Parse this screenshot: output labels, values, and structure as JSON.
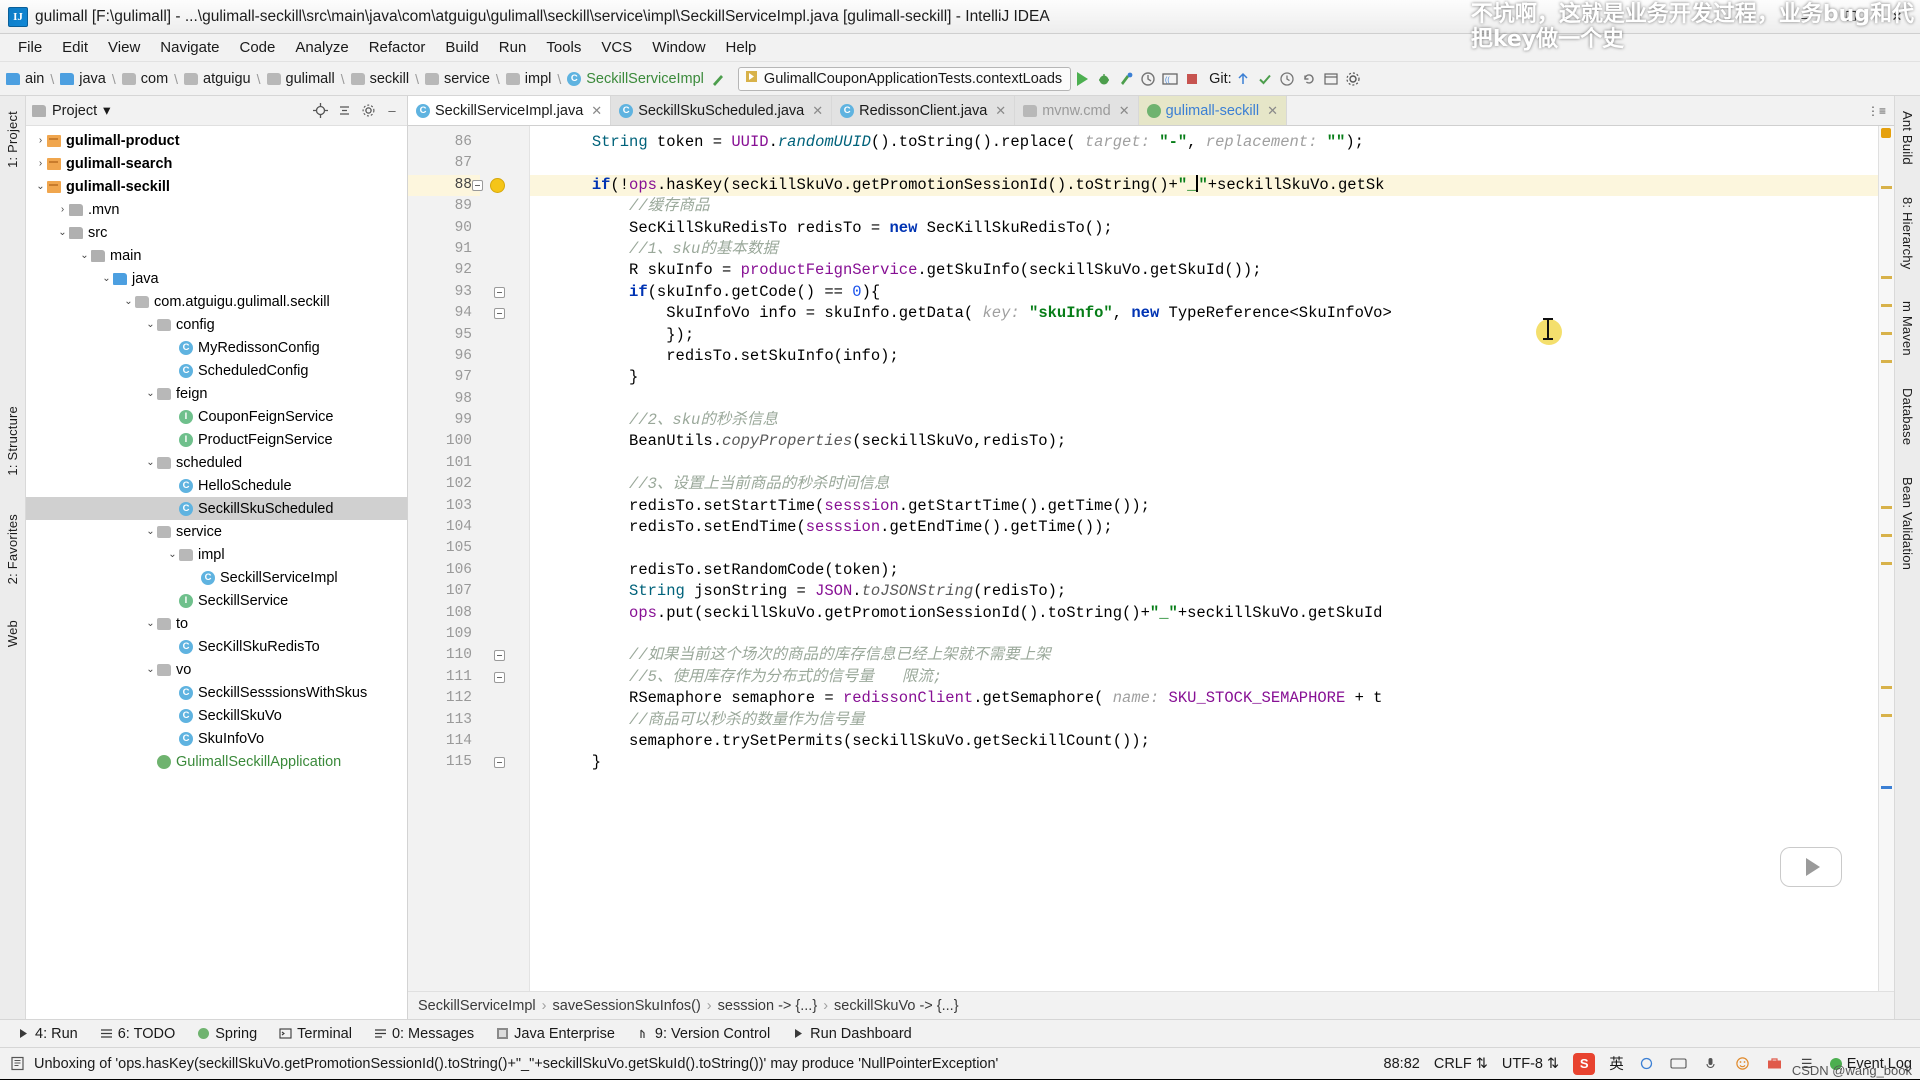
{
  "window": {
    "title": "gulimall [F:\\gulimall] - ...\\gulimall-seckill\\src\\main\\java\\com\\atguigu\\gulimall\\seckill\\service\\impl\\SeckillServiceImpl.java [gulimall-seckill] - IntelliJ IDEA",
    "logo_text": "IJ",
    "minimize": "–",
    "maximize": "❐",
    "close": "✕"
  },
  "menu": [
    {
      "label": "File"
    },
    {
      "label": "Edit"
    },
    {
      "label": "View"
    },
    {
      "label": "Navigate"
    },
    {
      "label": "Code"
    },
    {
      "label": "Analyze"
    },
    {
      "label": "Refactor"
    },
    {
      "label": "Build"
    },
    {
      "label": "Run"
    },
    {
      "label": "Tools"
    },
    {
      "label": "VCS"
    },
    {
      "label": "Window"
    },
    {
      "label": "Help"
    }
  ],
  "navbar": {
    "crumbs": [
      {
        "label": "ain",
        "icon": "folder-icon"
      },
      {
        "label": "java",
        "icon": "source-folder-icon"
      },
      {
        "label": "com",
        "icon": "package-icon"
      },
      {
        "label": "atguigu",
        "icon": "package-icon"
      },
      {
        "label": "gulimall",
        "icon": "package-icon"
      },
      {
        "label": "seckill",
        "icon": "package-icon"
      },
      {
        "label": "service",
        "icon": "package-icon"
      },
      {
        "label": "impl",
        "icon": "package-icon"
      },
      {
        "label": "SeckillServiceImpl",
        "icon": "class-icon"
      }
    ],
    "run_config": "GulimallCouponApplicationTests.contextLoads",
    "git_label": "Git:"
  },
  "project_panel": {
    "title": "Project",
    "dropdown_caret": "▾",
    "tree": [
      {
        "label": "gulimall-product",
        "depth": 1,
        "arrow": "›",
        "icon": "module-icon",
        "bold": true
      },
      {
        "label": "gulimall-search",
        "depth": 1,
        "arrow": "›",
        "icon": "module-icon",
        "bold": true
      },
      {
        "label": "gulimall-seckill",
        "depth": 1,
        "arrow": "⌄",
        "icon": "module-icon",
        "bold": true
      },
      {
        "label": ".mvn",
        "depth": 2,
        "arrow": "›",
        "icon": "folder-icon"
      },
      {
        "label": "src",
        "depth": 2,
        "arrow": "⌄",
        "icon": "folder-icon"
      },
      {
        "label": "main",
        "depth": 3,
        "arrow": "⌄",
        "icon": "folder-icon"
      },
      {
        "label": "java",
        "depth": 4,
        "arrow": "⌄",
        "icon": "source-folder-icon"
      },
      {
        "label": "com.atguigu.gulimall.seckill",
        "depth": 5,
        "arrow": "⌄",
        "icon": "package-icon"
      },
      {
        "label": "config",
        "depth": 6,
        "arrow": "⌄",
        "icon": "package-icon"
      },
      {
        "label": "MyRedissonConfig",
        "depth": 7,
        "arrow": "",
        "icon": "class-icon"
      },
      {
        "label": "ScheduledConfig",
        "depth": 7,
        "arrow": "",
        "icon": "class-icon"
      },
      {
        "label": "feign",
        "depth": 6,
        "arrow": "⌄",
        "icon": "package-icon"
      },
      {
        "label": "CouponFeignService",
        "depth": 7,
        "arrow": "",
        "icon": "interface-icon"
      },
      {
        "label": "ProductFeignService",
        "depth": 7,
        "arrow": "",
        "icon": "interface-icon"
      },
      {
        "label": "scheduled",
        "depth": 6,
        "arrow": "⌄",
        "icon": "package-icon"
      },
      {
        "label": "HelloSchedule",
        "depth": 7,
        "arrow": "",
        "icon": "class-icon"
      },
      {
        "label": "SeckillSkuScheduled",
        "depth": 7,
        "arrow": "",
        "icon": "class-icon",
        "selected": true
      },
      {
        "label": "service",
        "depth": 6,
        "arrow": "⌄",
        "icon": "package-icon"
      },
      {
        "label": "impl",
        "depth": 7,
        "arrow": "⌄",
        "icon": "package-icon"
      },
      {
        "label": "SeckillServiceImpl",
        "depth": 8,
        "arrow": "",
        "icon": "class-icon"
      },
      {
        "label": "SeckillService",
        "depth": 7,
        "arrow": "",
        "icon": "interface-icon"
      },
      {
        "label": "to",
        "depth": 6,
        "arrow": "⌄",
        "icon": "package-icon"
      },
      {
        "label": "SecKillSkuRedisTo",
        "depth": 7,
        "arrow": "",
        "icon": "class-icon"
      },
      {
        "label": "vo",
        "depth": 6,
        "arrow": "⌄",
        "icon": "package-icon"
      },
      {
        "label": "SeckillSesssionsWithSkus",
        "depth": 7,
        "arrow": "",
        "icon": "class-icon"
      },
      {
        "label": "SeckillSkuVo",
        "depth": 7,
        "arrow": "",
        "icon": "class-icon"
      },
      {
        "label": "SkuInfoVo",
        "depth": 7,
        "arrow": "",
        "icon": "class-icon"
      },
      {
        "label": "GulimallSeckillApplication",
        "depth": 6,
        "arrow": "",
        "icon": "spring-icon",
        "green": true
      }
    ]
  },
  "left_strip": [
    {
      "label": "1: Project"
    },
    {
      "label": "1: Structure"
    },
    {
      "label": "2: Favorites"
    },
    {
      "label": "Web"
    }
  ],
  "right_strip": [
    {
      "label": "Ant Build"
    },
    {
      "label": "8: Hierarchy"
    },
    {
      "label": "m Maven"
    },
    {
      "label": "Database"
    },
    {
      "label": "Bean Validation"
    }
  ],
  "editor_tabs": [
    {
      "label": "SeckillServiceImpl.java",
      "icon": "class-icon",
      "active": true,
      "close": "✕"
    },
    {
      "label": "SeckillSkuScheduled.java",
      "icon": "class-icon",
      "active": false,
      "close": "✕"
    },
    {
      "label": "RedissonClient.java",
      "icon": "class-icon",
      "active": false,
      "close": "✕"
    },
    {
      "label": "mvnw.cmd",
      "icon": "file-icon",
      "active": false,
      "close": "✕"
    },
    {
      "label": "gulimall-seckill",
      "icon": "maven-icon",
      "active": false,
      "close": "✕"
    }
  ],
  "code": {
    "first_line": 86,
    "current_line": 88,
    "lines": [
      {
        "n": 86,
        "html": "      <s class='mth'>String</s> token = <s class='fld'>UUID</s>.<s class='mthi'>randomUUID</s>().toString().replace( <s class='hint'>target:</s> <s class='st'>\"-\"</s>, <s class='hint'>replacement:</s> <s class='st'>\"\"</s>);"
      },
      {
        "n": 87,
        "html": ""
      },
      {
        "n": 88,
        "cur": true,
        "html": "      <s class='kw'>if</s>(!<s class='fld'>ops</s>.hasKey(seckillSkuVo.getPromotionSessionId().toString()+<s class='st'>\"_</s>CARET<s class='st'>\"</s>+seckillSkuVo.getSk"
      },
      {
        "n": 89,
        "html": "          <s class='cmz'>//缓存商品</s>"
      },
      {
        "n": 90,
        "html": "          SecKillSkuRedisTo redisTo = <s class='kw'>new</s> SecKillSkuRedisTo();"
      },
      {
        "n": 91,
        "html": "          <s class='cmz'>//1、sku的基本数据</s>"
      },
      {
        "n": 92,
        "html": "          R skuInfo = <s class='fld'>productFeignService</s>.getSkuInfo(seckillSkuVo.getSkuId());"
      },
      {
        "n": 93,
        "html": "          <s class='kw'>if</s>(skuInfo.getCode() == <s class='num'>0</s>){"
      },
      {
        "n": 94,
        "html": "              SkuInfoVo info = skuInfo.getData( <s class='hint'>key:</s> <s class='st'>\"skuInfo\"</s>, <s class='kw'>new</s> TypeReference&lt;SkuInfoVo&gt;"
      },
      {
        "n": 95,
        "html": "              });"
      },
      {
        "n": 96,
        "html": "              redisTo.setSkuInfo(info);"
      },
      {
        "n": 97,
        "html": "          }"
      },
      {
        "n": 98,
        "html": ""
      },
      {
        "n": 99,
        "html": "          <s class='cmz'>//2、sku的秒杀信息</s>"
      },
      {
        "n": 100,
        "html": "          BeanUtils.<s class='stat'>copyProperties</s>(seckillSkuVo,redisTo);"
      },
      {
        "n": 101,
        "html": ""
      },
      {
        "n": 102,
        "html": "          <s class='cmz'>//3、设置上当前商品的秒杀时间信息</s>"
      },
      {
        "n": 103,
        "html": "          redisTo.setStartTime(<s class='fld'>sesssion</s>.getStartTime().getTime());"
      },
      {
        "n": 104,
        "html": "          redisTo.setEndTime(<s class='fld'>sesssion</s>.getEndTime().getTime());"
      },
      {
        "n": 105,
        "html": ""
      },
      {
        "n": 106,
        "html": "          redisTo.setRandomCode(token);"
      },
      {
        "n": 107,
        "html": "          <s class='mth'>String</s> jsonString = <s class='fld'>JSON</s>.<s class='stat'>toJSONString</s>(redisTo);"
      },
      {
        "n": 108,
        "html": "          <s class='fld'>ops</s>.put(seckillSkuVo.getPromotionSessionId().toString()+<s class='st'>\"_\"</s>+seckillSkuVo.getSkuId"
      },
      {
        "n": 109,
        "html": ""
      },
      {
        "n": 110,
        "html": "          <s class='cmz'>//如果当前这个场次的商品的库存信息已经上架就不需要上架</s>"
      },
      {
        "n": 111,
        "html": "          <s class='cmz'>//5、使用库存作为分布式的信号量   限流;</s>"
      },
      {
        "n": 112,
        "html": "          RSemaphore semaphore = <s class='fld'>redissonClient</s>.getSemaphore( <s class='hint'>name:</s> <s class='fld'>SKU_STOCK_SEMAPHORE</s> + t"
      },
      {
        "n": 113,
        "html": "          <s class='cmz'>//商品可以秒杀的数量作为信号量</s>"
      },
      {
        "n": 114,
        "html": "          semaphore.trySetPermits(seckillSkuVo.getSeckillCount());"
      },
      {
        "n": 115,
        "html": "      }"
      }
    ]
  },
  "editor_breadcrumbs": [
    {
      "label": "SeckillServiceImpl"
    },
    {
      "label": "saveSessionSkuInfos()"
    },
    {
      "label": "sesssion -> {...}"
    },
    {
      "label": "seckillSkuVo -> {...}"
    }
  ],
  "tool_windows": [
    {
      "label": "4: Run",
      "mnemonic": "4",
      "icon": "run-icon"
    },
    {
      "label": "6: TODO",
      "mnemonic": "6",
      "icon": "todo-icon"
    },
    {
      "label": "Spring",
      "mnemonic": "",
      "icon": "spring-icon"
    },
    {
      "label": "Terminal",
      "mnemonic": "",
      "icon": "terminal-icon"
    },
    {
      "label": "0: Messages",
      "mnemonic": "0",
      "icon": "messages-icon"
    },
    {
      "label": "Java Enterprise",
      "mnemonic": "",
      "icon": "java-enterprise-icon"
    },
    {
      "label": "9: Version Control",
      "mnemonic": "9",
      "icon": "version-control-icon"
    },
    {
      "label": "Run Dashboard",
      "mnemonic": "",
      "icon": "dashboard-icon"
    }
  ],
  "status_bar": {
    "message": "Unboxing of 'ops.hasKey(seckillSkuVo.getPromotionSessionId().toString()+\"_\"+seckillSkuVo.getSkuId().toString())' may produce 'NullPointerException'",
    "caret_position": "88:82",
    "line_separator": "CRLF",
    "encoding": "UTF-8",
    "ime_sogou": "S",
    "ime_lang": "英",
    "event_log": "Event Log"
  },
  "overlays": {
    "watermark_top": "不坑啊，这就是业务开发过程，业务bug和代\n把key做一个史",
    "watermark_bottom": "CSDN @wang_book"
  },
  "colors": {
    "accent_blue": "#0033b3",
    "string_green": "#067d17",
    "comment_grey": "#8c8c8c",
    "field_purple": "#871094",
    "highlight_line": "#fcf6dd",
    "selection_grey": "#d0d0d0"
  }
}
